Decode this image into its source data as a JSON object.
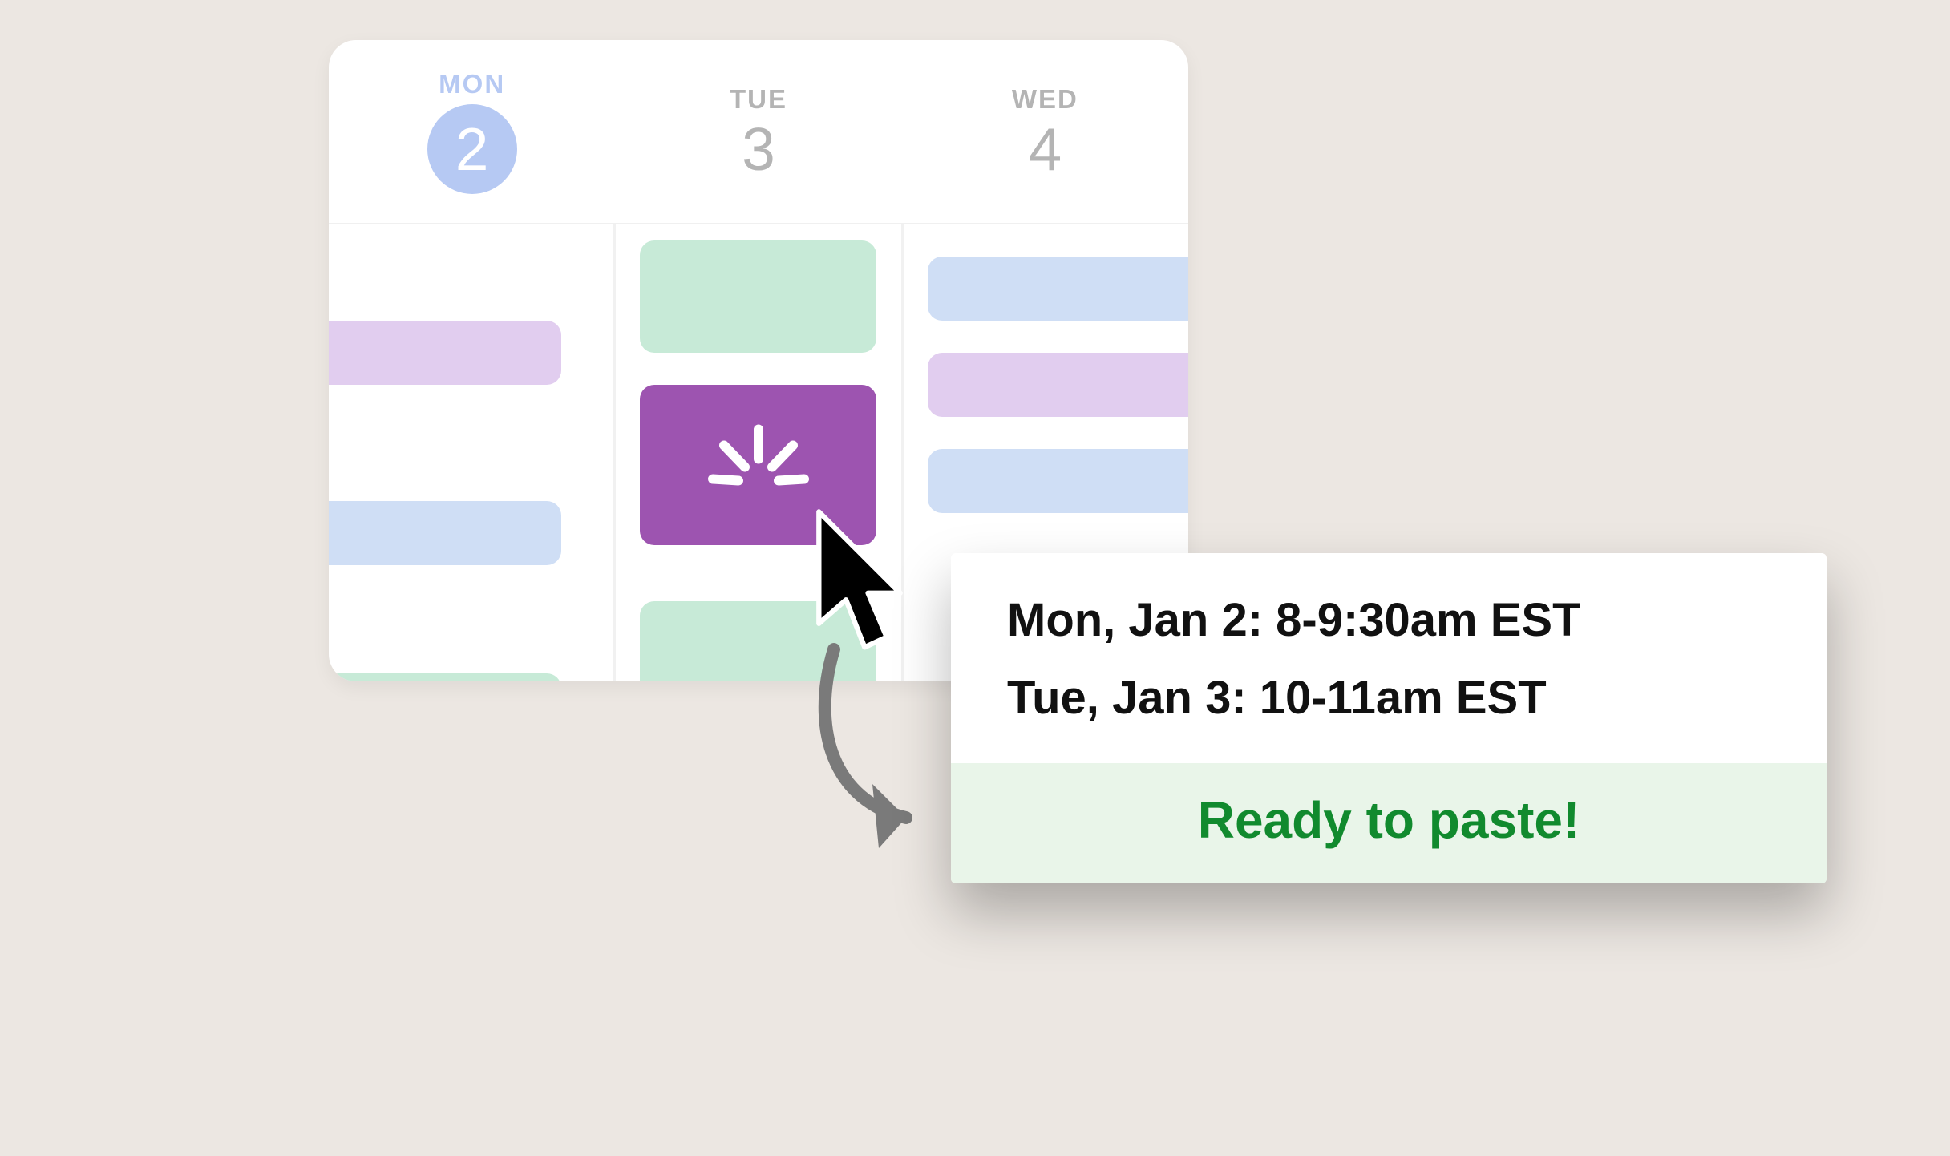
{
  "calendar": {
    "days": [
      {
        "abbr": "MON",
        "num": "2",
        "selected": true
      },
      {
        "abbr": "TUE",
        "num": "3",
        "selected": false
      },
      {
        "abbr": "WED",
        "num": "4",
        "selected": false
      }
    ],
    "selected_event_icon": "click-splash-icon"
  },
  "popup": {
    "lines": [
      "Mon, Jan 2: 8-9:30am EST",
      "Tue, Jan 3: 10-11am EST"
    ],
    "footer": "Ready to paste!"
  },
  "colors": {
    "accent_purple": "#9d54b0",
    "success_green": "#118a2e",
    "today_blue": "#b6c9f3"
  }
}
